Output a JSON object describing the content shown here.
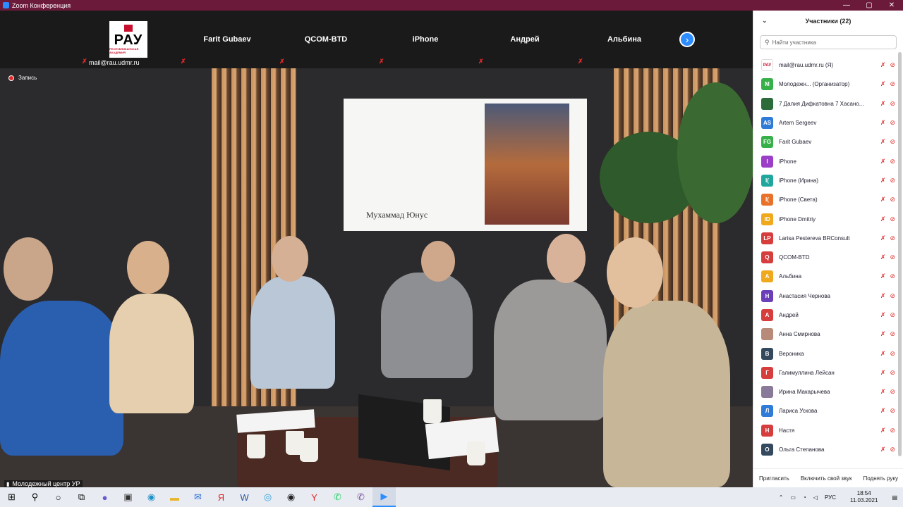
{
  "titlebar": {
    "title": "Zoom Конференция",
    "minimize": "—",
    "maximize": "▢",
    "close": "✕"
  },
  "thumbnails": [
    {
      "name": "",
      "user": "mail@rau.udmr.ru",
      "logo": true
    },
    {
      "name": "Farit Gubaev"
    },
    {
      "name": "QCOM-BTD"
    },
    {
      "name": "iPhone"
    },
    {
      "name": "Андрей"
    },
    {
      "name": "Альбина"
    }
  ],
  "logo": {
    "text": "РАУ",
    "subtitle": "РЕСПУБЛИКАНСКАЯ АКАДЕМИЯ"
  },
  "recording": {
    "label": "Запись"
  },
  "slide": {
    "caption": "Мухаммад Юнус"
  },
  "main_video": {
    "name": "Молодежный центр УР"
  },
  "panel": {
    "header": "Участники (22)",
    "search_placeholder": "Найти участника",
    "participants": [
      {
        "avatar": "РАУ",
        "color": "#ffffff",
        "name": "mail@rau.udmr.ru (Я)"
      },
      {
        "avatar": "М",
        "color": "#38b04a",
        "name": "Молодежн...  (Организатор)"
      },
      {
        "avatar": "",
        "color": "#2e6b3a",
        "name": "7 Далия Дифкатовна 7 Хасано..."
      },
      {
        "avatar": "AS",
        "color": "#2f7bd8",
        "name": "Artem Sergeev"
      },
      {
        "avatar": "FG",
        "color": "#38b04a",
        "name": "Farit Gubaev"
      },
      {
        "avatar": "I",
        "color": "#9b3fc8",
        "name": "iPhone"
      },
      {
        "avatar": "I(",
        "color": "#1fa79d",
        "name": "iPhone (Ирина)"
      },
      {
        "avatar": "I(",
        "color": "#e8722a",
        "name": "iPhone (Света)"
      },
      {
        "avatar": "ID",
        "color": "#f0a81c",
        "name": "iPhone Dmitriy"
      },
      {
        "avatar": "LP",
        "color": "#d63d3d",
        "name": "Larisa Pestereva  BRConsult"
      },
      {
        "avatar": "Q",
        "color": "#d63d3d",
        "name": "QCOM-BTD"
      },
      {
        "avatar": "А",
        "color": "#f0a81c",
        "name": "Альбина"
      },
      {
        "avatar": "Н",
        "color": "#6b3fb8",
        "name": "Анастасия Чернова"
      },
      {
        "avatar": "А",
        "color": "#d63d3d",
        "name": "Андрей"
      },
      {
        "avatar": "",
        "color": "#b88a7a",
        "name": "Анна Смирнова"
      },
      {
        "avatar": "В",
        "color": "#34495e",
        "name": "Вероника"
      },
      {
        "avatar": "Г",
        "color": "#d63d3d",
        "name": "Галимуллина Лейсан"
      },
      {
        "avatar": "",
        "color": "#8a7a9a",
        "name": "Ирина Макарычева"
      },
      {
        "avatar": "Л",
        "color": "#2f7bd8",
        "name": "Лариса Ускова"
      },
      {
        "avatar": "Н",
        "color": "#d63d3d",
        "name": "Настя"
      },
      {
        "avatar": "О",
        "color": "#34495e",
        "name": "Ольга Степанова"
      }
    ],
    "footer": {
      "invite": "Пригласить",
      "unmute": "Включить свой звук",
      "raise_hand": "Поднять руку"
    }
  },
  "taskbar": {
    "lang": "РУС",
    "time": "18:54",
    "date": "11.03.2021"
  }
}
